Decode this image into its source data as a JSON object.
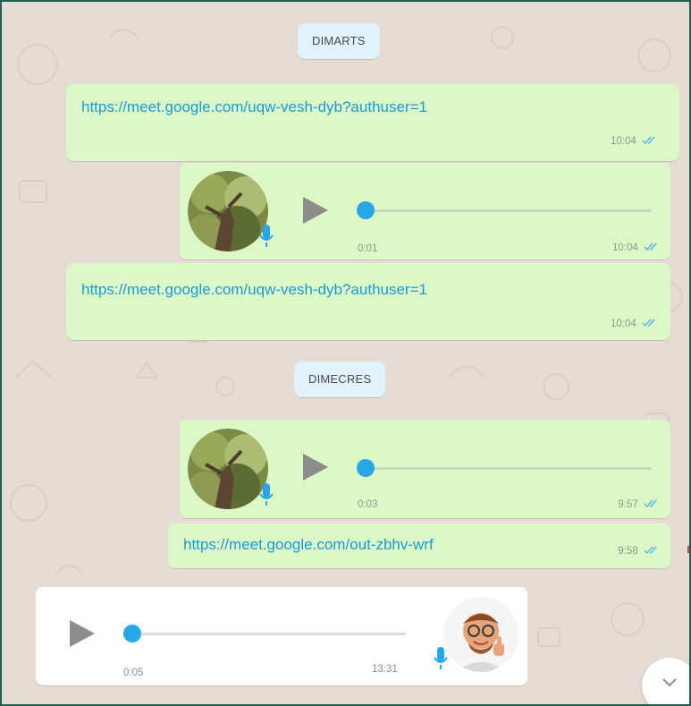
{
  "chat": {
    "date_separators": [
      {
        "label": "DIMARTS"
      },
      {
        "label": "DIMECRES"
      }
    ],
    "messages": [
      {
        "type": "link",
        "direction": "out",
        "text": "https://meet.google.com/uqw-vesh-dyb?authuser=1",
        "time": "10:04",
        "status": "read"
      },
      {
        "type": "voice",
        "direction": "out",
        "duration": "0:01",
        "time": "10:04",
        "status": "read"
      },
      {
        "type": "link",
        "direction": "out",
        "text": "https://meet.google.com/uqw-vesh-dyb?authuser=1",
        "time": "10:04",
        "status": "read"
      },
      {
        "type": "voice",
        "direction": "out",
        "duration": "0:03",
        "time": "9:57",
        "status": "read"
      },
      {
        "type": "link",
        "direction": "out",
        "text": "https://meet.google.com/out-zbhv-wrf",
        "time": "9:58",
        "status": "read"
      },
      {
        "type": "voice",
        "direction": "in",
        "duration": "0:05",
        "time": "13:31"
      }
    ]
  },
  "icons": {
    "play": "play-icon",
    "mic": "mic-icon",
    "ticks": "double-check-icon",
    "scroll": "chevron-down-icon"
  },
  "colors": {
    "outgoing_bubble": "#dcf8c6",
    "incoming_bubble": "#ffffff",
    "link": "#1a9bd7",
    "accent_blue": "#27a7e8",
    "read_ticks": "#4fb6ec",
    "chat_background": "#e5ddd5",
    "date_chip": "#e1f2fb"
  }
}
